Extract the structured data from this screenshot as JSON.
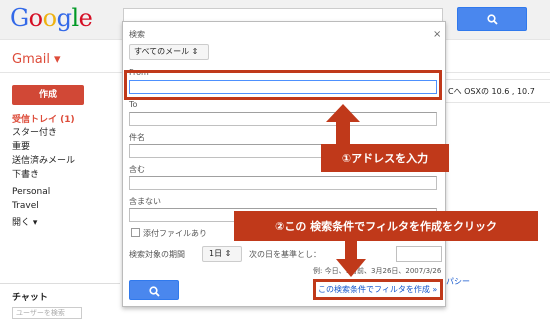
{
  "header": {
    "logo_letters": [
      {
        "ch": "G",
        "color": "#3369e8"
      },
      {
        "ch": "o",
        "color": "#d50f25"
      },
      {
        "ch": "o",
        "color": "#eeb211"
      },
      {
        "ch": "g",
        "color": "#3369e8"
      },
      {
        "ch": "l",
        "color": "#009925"
      },
      {
        "ch": "e",
        "color": "#d50f25"
      }
    ],
    "search_icon": "search-icon"
  },
  "sidebar": {
    "app_label": "Gmail ▾",
    "compose_label": "作成",
    "items": [
      {
        "label": "受信トレイ (1)",
        "bold": true
      },
      {
        "label": "スター付き"
      },
      {
        "label": "重要"
      },
      {
        "label": "送信済みメール"
      },
      {
        "label": "下書き"
      },
      {
        "label": "Personal"
      },
      {
        "label": "Travel"
      },
      {
        "label": "開く ▾"
      }
    ],
    "chat_title": "チャット",
    "chat_search_placeholder": "ユーザーを検索"
  },
  "background": {
    "mail_snippet": "Cへ OSXの 10.6 , 10.7",
    "link_fragment": "パシー"
  },
  "search_panel": {
    "title": "検索",
    "close": "×",
    "scope_select": "すべてのメール ⇕",
    "from_label": "From",
    "to_label": "To",
    "subject_label": "件名",
    "has_words_label": "含む",
    "doesnt_have_label": "含まない",
    "has_attachment_label": "添付ファイルあり",
    "date_within_label": "検索対象の期間",
    "date_within_value": "1日 ⇕",
    "date_of_label": "次の日を基準とし：",
    "date_example": "例: 今日、1日前、3月26日、2007/3/26",
    "create_filter_link": "この検索条件でフィルタを作成 »"
  },
  "annotations": {
    "step1": "①アドレスを入力",
    "step2": "②この 検索条件でフィルタを作成をクリック",
    "color": "#c0391a"
  }
}
